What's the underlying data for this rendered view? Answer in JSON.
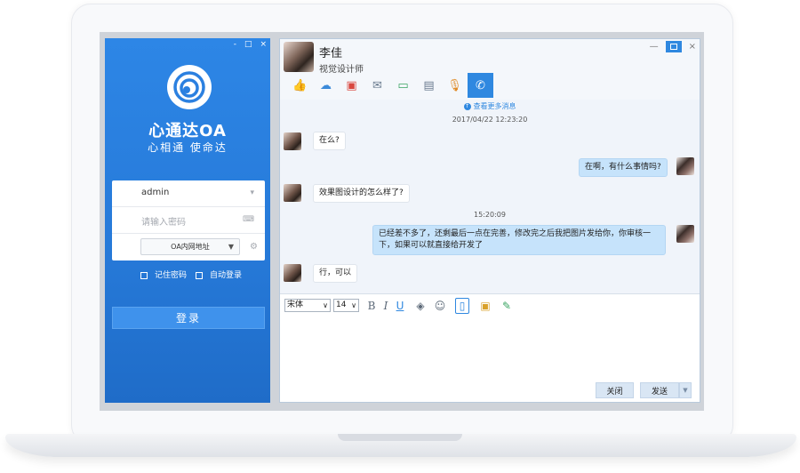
{
  "login": {
    "brand_title": "心通达OA",
    "brand_slogan": "心相通   使命达",
    "username_value": "admin",
    "password_placeholder": "请输入密码",
    "server_select_value": "OA内网地址",
    "remember_label": "记住密码",
    "autologin_label": "自动登录",
    "login_button": "登录",
    "window_controls": [
      "-",
      "□",
      "×"
    ]
  },
  "chat": {
    "contact_name": "李佳",
    "contact_title": "视觉设计师",
    "window_controls": [
      "—",
      "×"
    ],
    "toolbar_icons": [
      "thumbs-up-icon",
      "cloud-upload-icon",
      "folder-icon",
      "mail-icon",
      "screen-share-icon",
      "message-icon",
      "microphone-icon",
      "phone-call-icon"
    ],
    "view_more": "查看更多消息",
    "timestamp_1": "2017/04/22  12:23:20",
    "timestamp_2": "15:20:09",
    "messages": [
      {
        "from": "contact",
        "text": "在么?"
      },
      {
        "from": "me",
        "text": "在啊，有什么事情吗?"
      },
      {
        "from": "contact",
        "text": "效果图设计的怎么样了?"
      },
      {
        "from": "me",
        "text": "已经差不多了，还剩最后一点在完善，修改完之后我把图片发给你，你审核一下，如果可以就直接给开发了"
      },
      {
        "from": "contact",
        "text": "行，可以"
      }
    ],
    "font_family_value": "宋体",
    "font_size_value": "14",
    "format_icons": [
      "bold-icon",
      "italic-icon",
      "underline-icon",
      "fill-color-icon",
      "emoji-icon",
      "screenshot-icon",
      "image-icon",
      "pen-icon"
    ],
    "close_button": "关闭",
    "send_button": "发送"
  },
  "colors": {
    "login_blue": "#2679d8",
    "accent": "#2f88e0",
    "outgoing_bubble": "#c6e3fb"
  }
}
